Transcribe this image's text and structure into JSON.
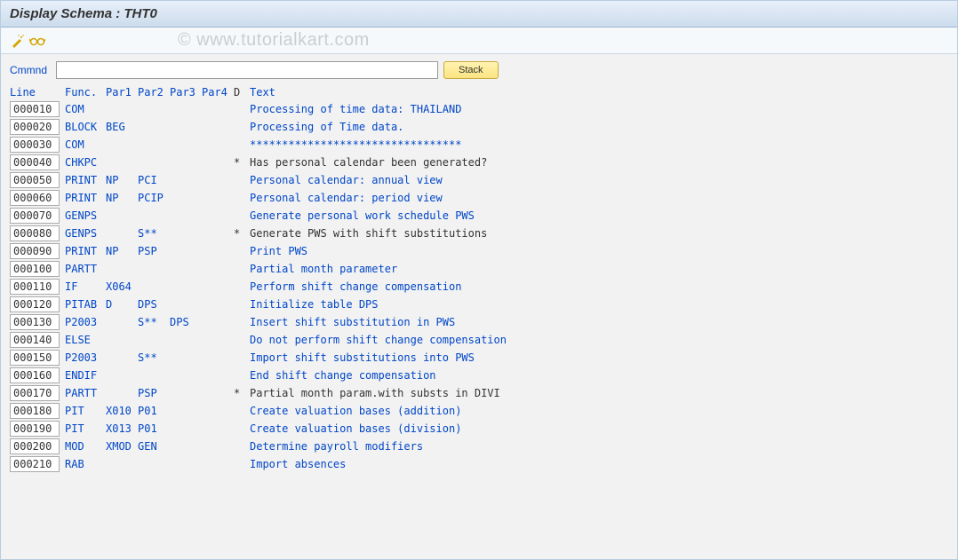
{
  "title": "Display Schema : THT0",
  "watermark": "© www.tutorialkart.com",
  "toolbar": {
    "icon1_name": "magic-wand-icon",
    "icon2_name": "glasses-icon"
  },
  "command": {
    "label": "Cmmnd",
    "value": "",
    "stack_label": "Stack"
  },
  "columns": {
    "line": "Line",
    "func": "Func.",
    "par1": "Par1",
    "par2": "Par2",
    "par3": "Par3",
    "par4": "Par4",
    "d": "D",
    "text": "Text"
  },
  "rows": [
    {
      "line": "000010",
      "func": "COM",
      "par1": "",
      "par2": "",
      "par3": "",
      "par4": "",
      "d": "",
      "text": "Processing of time data: THAILAND",
      "textBlack": false
    },
    {
      "line": "000020",
      "func": "BLOCK",
      "par1": "BEG",
      "par2": "",
      "par3": "",
      "par4": "",
      "d": "",
      "text": "Processing of Time data.",
      "textBlack": false
    },
    {
      "line": "000030",
      "func": "COM",
      "par1": "",
      "par2": "",
      "par3": "",
      "par4": "",
      "d": "",
      "text": "*********************************",
      "textBlack": false
    },
    {
      "line": "000040",
      "func": "CHKPC",
      "par1": "",
      "par2": "",
      "par3": "",
      "par4": "",
      "d": "*",
      "text": "Has personal calendar been generated?",
      "textBlack": true
    },
    {
      "line": "000050",
      "func": "PRINT",
      "par1": "NP",
      "par2": "PCI",
      "par3": "",
      "par4": "",
      "d": "",
      "text": "Personal calendar: annual view",
      "textBlack": false
    },
    {
      "line": "000060",
      "func": "PRINT",
      "par1": "NP",
      "par2": "PCIP",
      "par3": "",
      "par4": "",
      "d": "",
      "text": "Personal calendar: period view",
      "textBlack": false
    },
    {
      "line": "000070",
      "func": "GENPS",
      "par1": "",
      "par2": "",
      "par3": "",
      "par4": "",
      "d": "",
      "text": "Generate personal work schedule PWS",
      "textBlack": false
    },
    {
      "line": "000080",
      "func": "GENPS",
      "par1": "",
      "par2": "S**",
      "par3": "",
      "par4": "",
      "d": "*",
      "text": "Generate PWS with shift substitutions",
      "textBlack": true
    },
    {
      "line": "000090",
      "func": "PRINT",
      "par1": "NP",
      "par2": "PSP",
      "par3": "",
      "par4": "",
      "d": "",
      "text": "Print PWS",
      "textBlack": false
    },
    {
      "line": "000100",
      "func": "PARTT",
      "par1": "",
      "par2": "",
      "par3": "",
      "par4": "",
      "d": "",
      "text": "Partial month parameter",
      "textBlack": false
    },
    {
      "line": "000110",
      "func": "IF",
      "par1": "X064",
      "par2": "",
      "par3": "",
      "par4": "",
      "d": "",
      "text": "Perform shift change compensation",
      "textBlack": false
    },
    {
      "line": "000120",
      "func": "PITAB",
      "par1": "D",
      "par2": "DPS",
      "par3": "",
      "par4": "",
      "d": "",
      "text": "Initialize table DPS",
      "textBlack": false
    },
    {
      "line": "000130",
      "func": "P2003",
      "par1": "",
      "par2": "S**",
      "par3": "DPS",
      "par4": "",
      "d": "",
      "text": "Insert shift substitution in PWS",
      "textBlack": false
    },
    {
      "line": "000140",
      "func": "ELSE",
      "par1": "",
      "par2": "",
      "par3": "",
      "par4": "",
      "d": "",
      "text": "Do not perform shift change compensation",
      "textBlack": false
    },
    {
      "line": "000150",
      "func": "P2003",
      "par1": "",
      "par2": "S**",
      "par3": "",
      "par4": "",
      "d": "",
      "text": "Import shift substitutions into PWS",
      "textBlack": false
    },
    {
      "line": "000160",
      "func": "ENDIF",
      "par1": "",
      "par2": "",
      "par3": "",
      "par4": "",
      "d": "",
      "text": "End shift change compensation",
      "textBlack": false
    },
    {
      "line": "000170",
      "func": "PARTT",
      "par1": "",
      "par2": "PSP",
      "par3": "",
      "par4": "",
      "d": "*",
      "text": "Partial month param.with substs in DIVI",
      "textBlack": true
    },
    {
      "line": "000180",
      "func": "PIT",
      "par1": "X010",
      "par2": "P01",
      "par3": "",
      "par4": "",
      "d": "",
      "text": "Create valuation bases (addition)",
      "textBlack": false
    },
    {
      "line": "000190",
      "func": "PIT",
      "par1": "X013",
      "par2": "P01",
      "par3": "",
      "par4": "",
      "d": "",
      "text": "Create valuation bases (division)",
      "textBlack": false
    },
    {
      "line": "000200",
      "func": "MOD",
      "par1": "XMOD",
      "par2": "GEN",
      "par3": "",
      "par4": "",
      "d": "",
      "text": "Determine payroll modifiers",
      "textBlack": false
    },
    {
      "line": "000210",
      "func": "RAB",
      "par1": "",
      "par2": "",
      "par3": "",
      "par4": "",
      "d": "",
      "text": "Import absences",
      "textBlack": false
    }
  ]
}
